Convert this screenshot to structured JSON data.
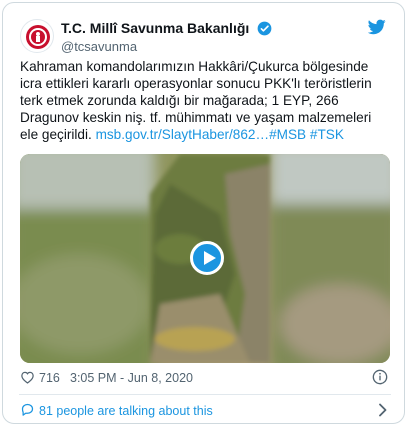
{
  "account": {
    "display_name": "T.C. Millî Savunma Bakanlığı",
    "handle": "@tcsavunma",
    "verified": true
  },
  "tweet": {
    "text": "Kahraman komandolarımızın Hakkâri/Çukurca bölgesinde icra ettikleri kararlı operasyonlar sonucu PKK'lı teröristlerin terk etmek zorunda kaldığı bir mağarada; 1 EYP, 266 Dragunov keskin niş. tf. mühimmatı ve yaşam malzemeleri ele geçirildi.",
    "link": "msb.gov.tr/SlaytHaber/862…",
    "hashtag_1": "#MSB",
    "hashtag_2": "#TSK"
  },
  "meta": {
    "likes": "716",
    "timestamp": "3:05 PM - Jun 8, 2020"
  },
  "footer": {
    "talking_text": "81 people are talking about this"
  },
  "icons": {
    "bird": "twitter-bird-icon",
    "verified": "verified-badge-icon",
    "heart": "heart-icon",
    "info": "info-icon",
    "chat": "chat-bubble-icon",
    "chevron": "chevron-right-icon",
    "play": "play-icon"
  },
  "colors": {
    "accent": "#1b95e0",
    "text": "#0f1419",
    "secondary": "#536471",
    "logo_red": "#c8102e"
  }
}
